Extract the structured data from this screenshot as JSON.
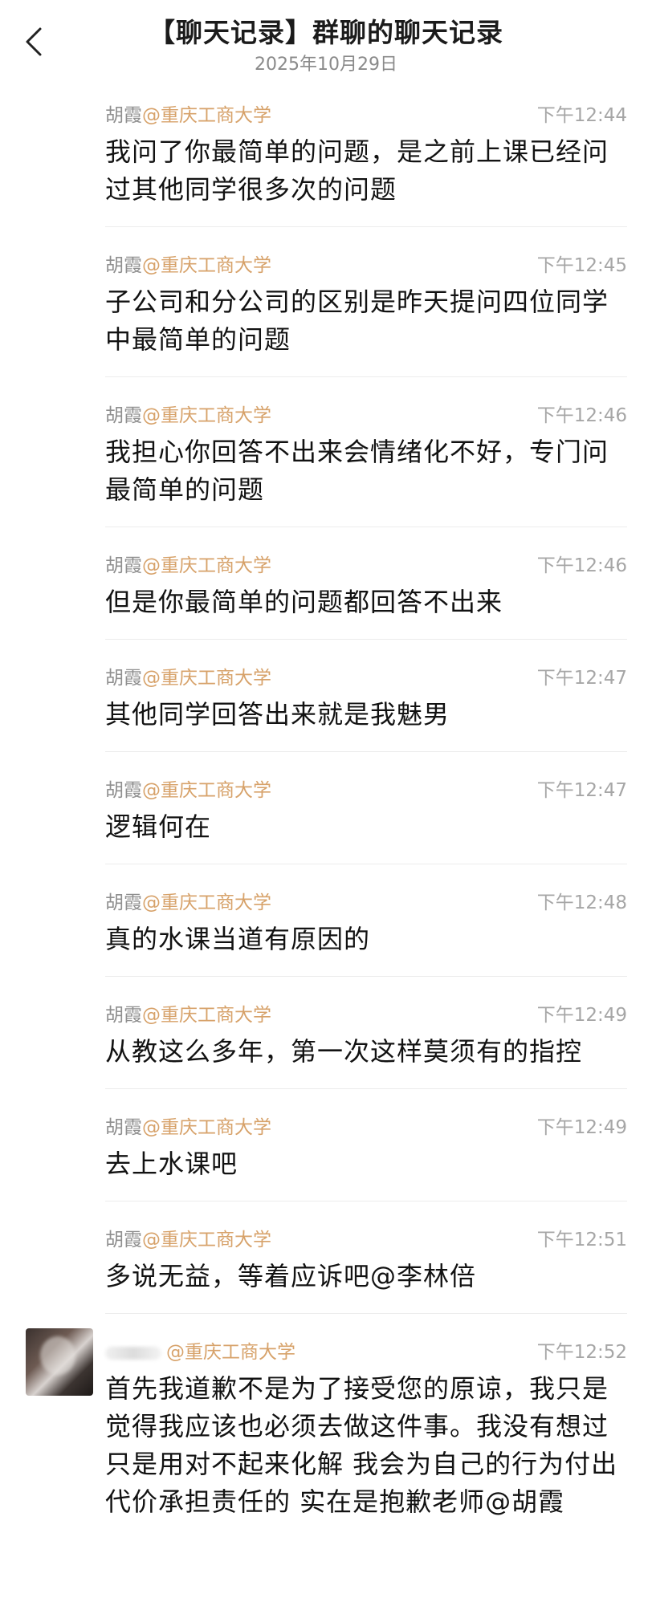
{
  "header": {
    "title": "【聊天记录】群聊的聊天记录",
    "date": "2025年10月29日"
  },
  "messages": [
    {
      "sender_name": "胡霞",
      "sender_org": "@重庆工商大学",
      "time": "下午12:44",
      "text": "我问了你最简单的问题，是之前上课已经问过其他同学很多次的问题"
    },
    {
      "sender_name": "胡霞",
      "sender_org": "@重庆工商大学",
      "time": "下午12:45",
      "text": "子公司和分公司的区别是昨天提问四位同学中最简单的问题"
    },
    {
      "sender_name": "胡霞",
      "sender_org": "@重庆工商大学",
      "time": "下午12:46",
      "text": "我担心你回答不出来会情绪化不好，专门问最简单的问题"
    },
    {
      "sender_name": "胡霞",
      "sender_org": "@重庆工商大学",
      "time": "下午12:46",
      "text": "但是你最简单的问题都回答不出来"
    },
    {
      "sender_name": "胡霞",
      "sender_org": "@重庆工商大学",
      "time": "下午12:47",
      "text": "其他同学回答出来就是我魅男"
    },
    {
      "sender_name": "胡霞",
      "sender_org": "@重庆工商大学",
      "time": "下午12:47",
      "text": "逻辑何在"
    },
    {
      "sender_name": "胡霞",
      "sender_org": "@重庆工商大学",
      "time": "下午12:48",
      "text": "真的水课当道有原因的"
    },
    {
      "sender_name": "胡霞",
      "sender_org": "@重庆工商大学",
      "time": "下午12:49",
      "text": "从教这么多年，第一次这样莫须有的指控"
    },
    {
      "sender_name": "胡霞",
      "sender_org": "@重庆工商大学",
      "time": "下午12:49",
      "text": "去上水课吧"
    },
    {
      "sender_name": "胡霞",
      "sender_org": "@重庆工商大学",
      "time": "下午12:51",
      "text": "多说无益，等着应诉吧@李林倍"
    },
    {
      "sender_org": "@重庆工商大学",
      "time": "下午12:52",
      "text": "首先我道歉不是为了接受您的原谅，我只是觉得我应该也必须去做这件事。我没有想过只是用对不起来化解 我会为自己的行为付出代价承担责任的 实在是抱歉老师@胡霞"
    }
  ]
}
